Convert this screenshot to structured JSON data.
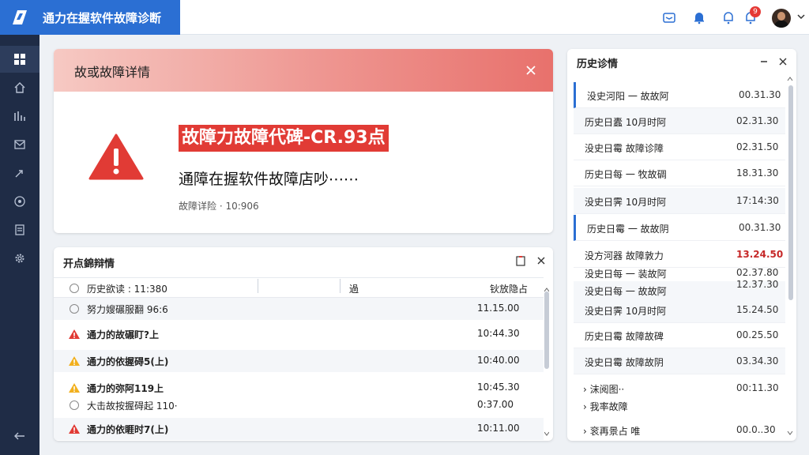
{
  "app": {
    "title": "通力在握软件故障诊断"
  },
  "topbar": {
    "notification_count": "9"
  },
  "fault_card": {
    "title": "故或故障详情",
    "code": "故障力故障代碑-CR.93点",
    "description": "通障在握软件故障店吵⋯⋯",
    "meta": "故障详险 · 10:906"
  },
  "events_card": {
    "title": "开点錦辩情",
    "columns": {
      "first": "历史欲读 : 11:380",
      "mid": "過",
      "right": "钬放隐占"
    },
    "rows": [
      {
        "icon": "radio-icon",
        "label": "努力嫂碾服翻 96:6",
        "time": "11.15.00",
        "bold": false
      },
      {
        "icon": "warning-red-icon",
        "label": "通力的故碾盯?上",
        "time": "10:44.30",
        "bold": true
      },
      {
        "icon": "warning-yellow-icon",
        "label": "通力的依握碍5(上)",
        "time": "10:40.00",
        "bold": true
      },
      {
        "icon": "warning-yellow-icon",
        "label": "通力的弥阿119上",
        "time": "10:45.30",
        "bold": true
      },
      {
        "icon": "radio-icon",
        "label": "大击故按握碍起 110·",
        "time": "0:37.00",
        "bold": false
      },
      {
        "icon": "warning-red-icon",
        "label": "通力的依睚时7(上)",
        "time": "10:11.00",
        "bold": true
      }
    ]
  },
  "history_card": {
    "title": "历史诊情",
    "rows": [
      {
        "label": "没史河阳 一 故故阿",
        "time": "00.31.30"
      },
      {
        "label": "历史日蠹  10月时阿",
        "time": "02.31.30"
      },
      {
        "label": "没史日霉  故障诊障",
        "time": "02.31.50"
      },
      {
        "label": "历史日每 一 牧故碉",
        "time": "18.31.30"
      },
      {
        "label": "没史日霁  10月时阿",
        "time": "17:14:30"
      },
      {
        "label": "历史日霉 一 故故阴",
        "time": "00.31.30"
      },
      {
        "label": "没方河器 故障敦力",
        "time": "13.24.50"
      },
      {
        "label": "没史日每 一 装故阿",
        "time": "02.37.80"
      },
      {
        "label": "没史日每 一 故故阿",
        "time": "12.37.30"
      },
      {
        "label": "没史日霁  10月时阿",
        "time": "15.24.50"
      },
      {
        "label": "历史日霉 故障故碑",
        "time": "00.25.50"
      },
      {
        "label": "没史日霉 故障故阴",
        "time": "03.34.30"
      }
    ],
    "collapsed": [
      {
        "label": "› 沫阅图··",
        "time": "00:11.30"
      },
      {
        "label": "› 我率故障",
        "time": ""
      },
      {
        "label": "› 衮再景占 唯",
        "time": "00.0..30"
      }
    ]
  },
  "colors": {
    "accent": "#2b6fd3",
    "nav_bg": "#1f2c46",
    "danger": "#e13b35",
    "warning": "#f2b01e"
  }
}
